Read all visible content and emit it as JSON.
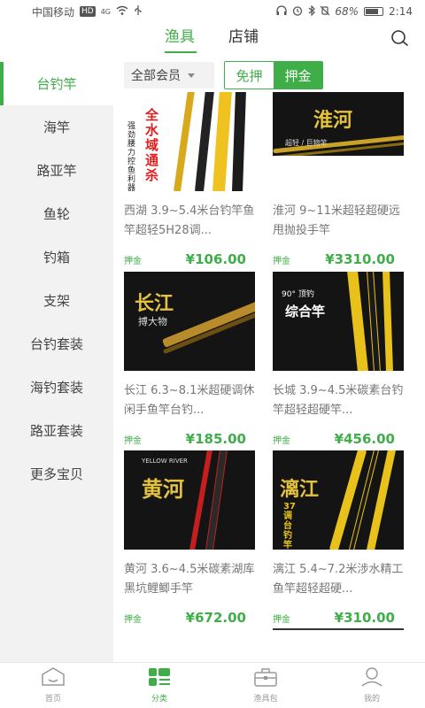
{
  "status_bar": {
    "carrier": "中国移动",
    "hd": "HD",
    "network": "4G",
    "battery": "68%",
    "time": "2:14"
  },
  "header": {
    "tabs": [
      {
        "label": "渔具",
        "active": true
      },
      {
        "label": "店铺",
        "active": false
      }
    ]
  },
  "sidebar": {
    "items": [
      {
        "label": "台钓竿",
        "active": true
      },
      {
        "label": "海竿"
      },
      {
        "label": "路亚竿"
      },
      {
        "label": "鱼轮"
      },
      {
        "label": "钓箱"
      },
      {
        "label": "支架"
      },
      {
        "label": "台钓套装"
      },
      {
        "label": "海钓套装"
      },
      {
        "label": "路亚套装"
      },
      {
        "label": "更多宝贝"
      }
    ]
  },
  "filter": {
    "member_select": "全部会员",
    "segments": [
      {
        "label": "免押",
        "active": false
      },
      {
        "label": "押金",
        "active": true
      }
    ]
  },
  "products": [
    {
      "name": "西湖 3.9~5.4米台钓竿鱼竿超轻5H28调...",
      "deposit_label": "押金",
      "price": "¥106.00",
      "thumb_text": "全水域通杀",
      "thumb_sub": "强劲腰力 控鱼利器"
    },
    {
      "name": "淮河 9~11米超轻超硬远甩抛投手竿",
      "deposit_label": "押金",
      "price": "¥3310.00",
      "thumb_text": "淮河",
      "thumb_sub": "超轻 / 巨物竿"
    },
    {
      "name": "长江 6.3~8.1米超硬调休闲手鱼竿台钓...",
      "deposit_label": "押金",
      "price": "¥185.00",
      "thumb_text": "长江",
      "thumb_sub": "搏大物"
    },
    {
      "name": "长城 3.9~4.5米碳素台钓竿超轻超硬竿...",
      "deposit_label": "押金",
      "price": "¥456.00",
      "thumb_text": "综合竿",
      "thumb_sub": "90° 顶钓"
    },
    {
      "name": "黄河 3.6~4.5米碳素湖库黑坑鲤鲫手竿",
      "deposit_label": "押金",
      "price": "¥672.00",
      "thumb_text": "黄河",
      "thumb_sub": "YELLOW RIVER"
    },
    {
      "name": "漓江 5.4~7.2米涉水精工鱼竿超轻超硬...",
      "deposit_label": "押金",
      "price": "¥310.00",
      "thumb_text": "漓江",
      "thumb_sub": "37 调 台钓竿"
    }
  ],
  "bottom_nav": {
    "items": [
      {
        "label": "首页",
        "icon": "home-icon"
      },
      {
        "label": "分类",
        "icon": "category-icon",
        "active": true
      },
      {
        "label": "渔具包",
        "icon": "tackle-bag-icon"
      },
      {
        "label": "我的",
        "icon": "profile-icon"
      }
    ]
  },
  "colors": {
    "accent": "#3fae49",
    "sidebar_bg": "#f2f2f2"
  }
}
